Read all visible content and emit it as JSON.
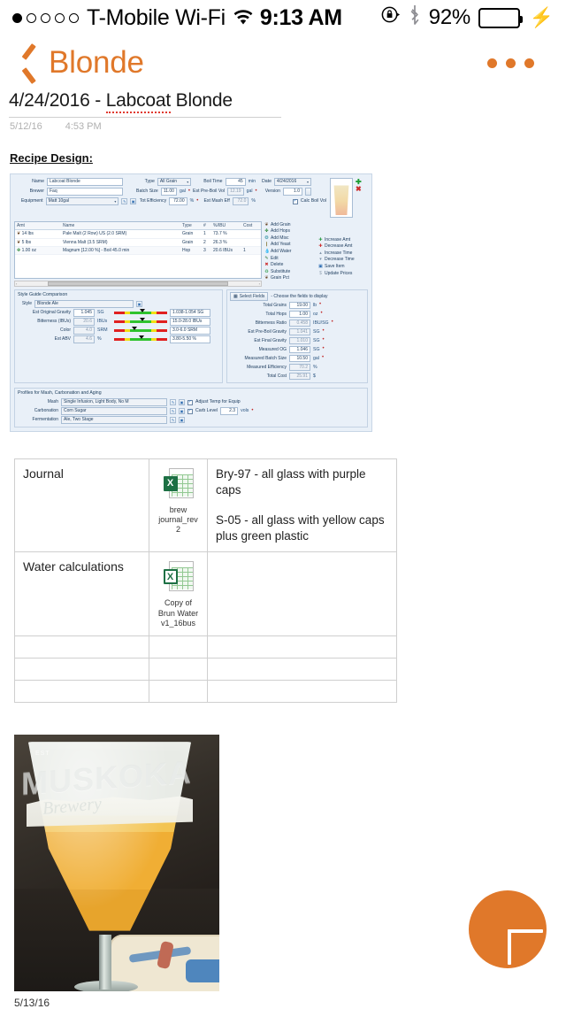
{
  "status_bar": {
    "signal_total": 5,
    "signal_filled": 1,
    "carrier": "T-Mobile Wi-Fi",
    "wifi_icon": "wifi-icon",
    "time": "9:13 AM",
    "rotation_lock_icon": "rotation-lock-icon",
    "bluetooth_icon": "bluetooth-icon",
    "battery_percent": "92%",
    "battery_fill": 92,
    "battery_color": "#4CD663",
    "charging_icon": "lightning-bolt-icon"
  },
  "nav": {
    "back_icon": "chevron-left-icon",
    "back_label": "Blonde",
    "more_icon": "more-options-icon",
    "accent_color": "#E0782A"
  },
  "note": {
    "title_prefix": "4/24/2016 - ",
    "title_misspelled": "Labcoat",
    "title_suffix": " Blonde",
    "date": "5/12/16",
    "time": "4:53 PM",
    "section_heading": "Recipe Design:"
  },
  "recipe_screenshot": {
    "header_fields": {
      "name_label": "Name",
      "name_value": "Labcoat Blonde",
      "brewer_label": "Brewer",
      "brewer_value": "Faq",
      "equipment_label": "Equipment",
      "equipment_value": "Matt 10gal",
      "type_label": "Type",
      "type_value": "All Grain",
      "batch_size_label": "Batch Size",
      "batch_size_value": "11.00",
      "batch_size_unit": "gal",
      "tot_efficiency_label": "Tot Efficiency",
      "tot_efficiency_value": "72.00",
      "tot_efficiency_unit": "%",
      "boil_time_label": "Boil Time",
      "boil_time_value": "45",
      "boil_time_unit": "min",
      "est_pre_boil_vol_label": "Est Pre-Boil Vol",
      "est_pre_boil_vol_value": "12.19",
      "est_pre_boil_vol_unit": "gal",
      "est_mash_eff_label": "Est Mash Eff",
      "est_mash_eff_value": "72.0",
      "est_mash_eff_unit": "%",
      "date_label": "Date",
      "date_value": "4/24/2016",
      "version_label": "Version",
      "version_value": "1.0",
      "calc_boil_vol_label": "Calc Boil Vol",
      "calc_boil_vol_checked": true
    },
    "grid": {
      "columns": [
        "Amt",
        "Name",
        "Type",
        "#",
        "%/IBU",
        "Cost"
      ],
      "rows": [
        {
          "icon": "grain-icon",
          "amt": "14 lbs",
          "name": "Pale Malt (2 Row) US (2.0 SRM)",
          "type": "Grain",
          "num": "1",
          "pct": "73.7 %",
          "cost": ""
        },
        {
          "icon": "grain-icon",
          "amt": "5 lbs",
          "name": "Vienna Malt (3.5 SRM)",
          "type": "Grain",
          "num": "2",
          "pct": "26.3 %",
          "cost": ""
        },
        {
          "icon": "hop-icon",
          "amt": "1.00 oz",
          "name": "Magnum [12.00 %] - Boil 45.0 min",
          "type": "Hop",
          "num": "3",
          "pct": "20.6 IBUs",
          "cost": "1"
        }
      ]
    },
    "action_menu": [
      {
        "icon": "grain-icon",
        "label": "Add Grain"
      },
      {
        "icon": "hop-icon",
        "label": "Add Hops"
      },
      {
        "icon": "misc-icon",
        "label": "Add Misc"
      },
      {
        "icon": "yeast-icon",
        "label": "Add Yeast"
      },
      {
        "icon": "water-icon",
        "label": "Add Water"
      },
      {
        "icon": "edit-icon",
        "label": "Edit"
      },
      {
        "icon": "delete-icon",
        "label": "Delete"
      },
      {
        "icon": "substitute-icon",
        "label": "Substitute"
      },
      {
        "icon": "grain-pct-icon",
        "label": "Grain Pct"
      }
    ],
    "amount_menu": [
      {
        "icon": "increase-icon",
        "label": "Increase Amt"
      },
      {
        "icon": "decrease-icon",
        "label": "Decrease Amt"
      },
      {
        "icon": "increase-time-icon",
        "label": "Increase Time"
      },
      {
        "icon": "decrease-time-icon",
        "label": "Decrease Time"
      },
      {
        "icon": "save-icon",
        "label": "Save Item"
      },
      {
        "icon": "prices-icon",
        "label": "Update Prices"
      }
    ],
    "style_guide": {
      "title": "Style Guide Comparison",
      "style_label": "Style",
      "style_value": "Blonde Ale",
      "rows": [
        {
          "label": "Est Original Gravity",
          "value": "1.045",
          "unit": "SG",
          "range": "1.038-1.054 SG",
          "marker": 48
        },
        {
          "label": "Bitterness (IBUs)",
          "value": "20.6",
          "unit": "IBUs",
          "range": "15.0-28.0 IBUs",
          "marker": 48
        },
        {
          "label": "Color",
          "value": "4.0",
          "unit": "SRM",
          "range": "3.0-6.0 SRM",
          "marker": 34
        },
        {
          "label": "Est ABV",
          "value": "4.6",
          "unit": "%",
          "range": "3.80-5.50 %",
          "marker": 47
        }
      ]
    },
    "fields_panel": {
      "select_fields_button": "Select Fields",
      "select_fields_hint": "- Choose the fields to display",
      "rows": [
        {
          "label": "Total Grains",
          "value": "19.00",
          "unit": "lb"
        },
        {
          "label": "Total Hops",
          "value": "1.00",
          "unit": "oz"
        },
        {
          "label": "Bitterness Ratio",
          "value": "0.458",
          "unit": "IBU/SG"
        },
        {
          "label": "Est Pre-Boil Gravity",
          "value": "1.041",
          "unit": "SG"
        },
        {
          "label": "Est Final Gravity",
          "value": "1.010",
          "unit": "SG"
        },
        {
          "label": "Measured OG",
          "value": "1.046",
          "unit": "SG"
        },
        {
          "label": "Measured Batch Size",
          "value": "10.50",
          "unit": "gal"
        },
        {
          "label": "Measured Efficiency",
          "value": "70.2",
          "unit": "%"
        },
        {
          "label": "Total Cost",
          "value": "25.91",
          "unit": "$"
        }
      ]
    },
    "profiles": {
      "title": "Profiles for Mash, Carbonation and Aging",
      "mash_label": "Mash",
      "mash_value": "Single Infusion, Light Body, No M",
      "adjust_temp_label": "Adjust Temp for Equip",
      "adjust_temp_checked": true,
      "carbonation_label": "Carbonation",
      "carbonation_value": "Corn Sugar",
      "carb_level_label": "Carb Level",
      "carb_level_value": "2.3",
      "carb_level_unit": "vols",
      "fermentation_label": "Fermentation",
      "fermentation_value": "Ale, Two Stage"
    }
  },
  "attachments_table": {
    "rows": [
      {
        "label": "Journal",
        "file_icon": "excel-file-icon",
        "file_name": "brew journal_rev2",
        "notes": [
          "Bry-97 - all glass with purple caps",
          "S-05 - all glass with yellow caps plus green plastic"
        ]
      },
      {
        "label": "Water calculations",
        "file_icon": "excel-file-icon",
        "file_name": "Copy of Brun Water v1_16bus",
        "notes": []
      }
    ],
    "empty_row_count": 3
  },
  "photo": {
    "alt_name": "beer-glass-photo",
    "etch_est": "EST",
    "etch_brand": "MUSKOKA",
    "etch_sub": "Brewery",
    "caption_date": "5/13/16"
  },
  "fab": {
    "icon": "plus-icon",
    "label": "New",
    "color": "#E0782A"
  }
}
